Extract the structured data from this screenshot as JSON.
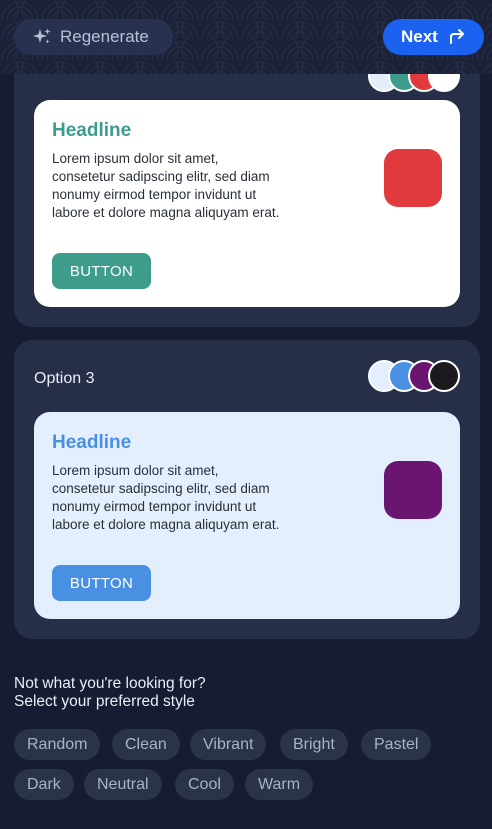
{
  "header": {
    "regenerate_label": "Regenerate",
    "next_label": "Next",
    "regenerate_icon": "sparkles-icon",
    "next_icon": "redo-arrow-icon"
  },
  "options": [
    {
      "title": "",
      "swatches": [
        "#e2ecfa",
        "#3d9c8c",
        "#e03a3e",
        "#ffffff"
      ],
      "card": {
        "background": "#ffffff",
        "headline": "Headline",
        "headline_color": "#3d9c8c",
        "body": "Lorem ipsum dolor sit amet, consetetur sadipscing elitr, sed diam nonumy eirmod tempor invidunt ut labore et dolore magna aliquyam erat.",
        "button_label": "BUTTON",
        "button_color": "#3d9c8c",
        "accent_color": "#e03a3e"
      }
    },
    {
      "title": "Option 3",
      "swatches": [
        "#e3effd",
        "#4a90e2",
        "#6a1670",
        "#1b1b1f"
      ],
      "card": {
        "background": "#e3effd",
        "headline": "Headline",
        "headline_color": "#4a90e2",
        "body": "Lorem ipsum dolor sit amet, consetetur sadipscing elitr, sed diam nonumy eirmod tempor invidunt ut labore et dolore magna aliquyam erat.",
        "button_label": "BUTTON",
        "button_color": "#4a90e2",
        "accent_color": "#6a1670"
      }
    }
  ],
  "prompt": {
    "line1": "Not what you're looking for?",
    "line2": "Select your preferred style"
  },
  "styles": [
    "Random",
    "Clean",
    "Vibrant",
    "Bright",
    "Pastel",
    "Dark",
    "Neutral",
    "Cool",
    "Warm"
  ],
  "colors": {
    "page_bg": "#161c31",
    "panel_bg": "#262e48",
    "chip_bg": "#2b3349",
    "primary": "#1b62f0"
  }
}
